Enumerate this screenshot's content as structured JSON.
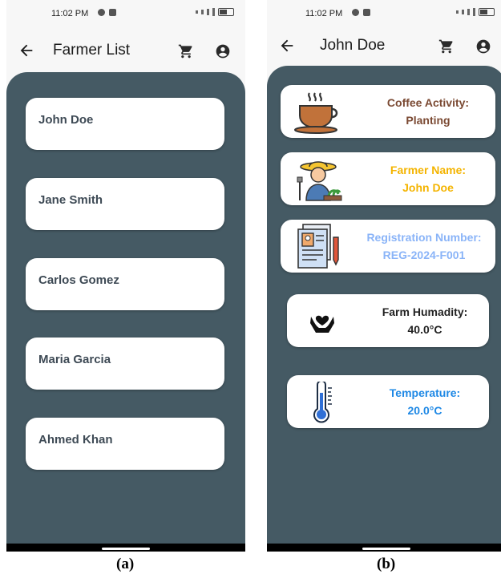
{
  "status": {
    "time": "11:02 PM"
  },
  "screen_a": {
    "title": "Farmer List",
    "farmers": [
      "John Doe",
      "Jane Smith",
      "Carlos Gomez",
      "Maria Garcia",
      "Ahmed Khan"
    ],
    "caption": "(a)"
  },
  "screen_b": {
    "title": "John Doe",
    "coffee_activity": {
      "label": "Coffee Activity:",
      "value": "Planting",
      "color": "#7b4a33"
    },
    "farmer_name": {
      "label": "Farmer Name:",
      "value": "John Doe",
      "color": "#f4b400"
    },
    "registration": {
      "label": "Registration Number:",
      "value": "REG-2024-F001",
      "color": "#8ab4f8"
    },
    "humidity": {
      "label": "Farm Humadity:",
      "value": "40.0°C",
      "color": "#222222"
    },
    "temperature": {
      "label": "Temperature:",
      "value": "20.0°C",
      "color": "#1e88e5"
    },
    "caption": "(b)"
  },
  "icons": {
    "back": "back-arrow-icon",
    "cart": "shopping-cart-icon",
    "account": "account-circle-icon",
    "coffee": "coffee-cup-icon",
    "farmer": "farmer-icon",
    "document": "registration-document-icon",
    "humidity": "hands-heart-icon",
    "thermometer": "thermometer-icon"
  }
}
